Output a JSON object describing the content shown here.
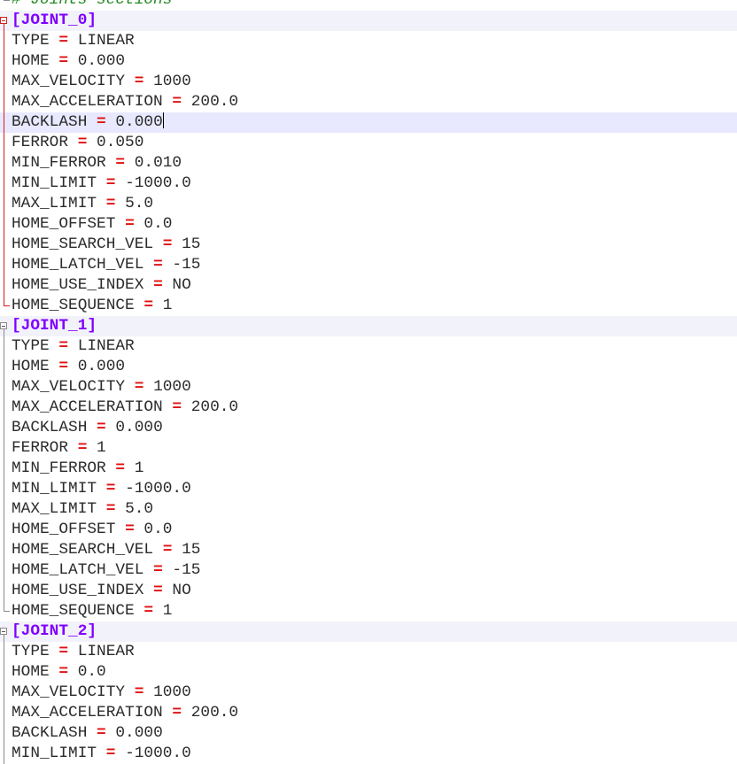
{
  "editor": {
    "comment": "# Joints sections -------------",
    "sections": [
      {
        "header": "[JOINT_0]",
        "entries": [
          {
            "key": "TYPE",
            "value": "LINEAR"
          },
          {
            "key": "HOME",
            "value": "0.000"
          },
          {
            "key": "MAX_VELOCITY",
            "value": "1000"
          },
          {
            "key": "MAX_ACCELERATION",
            "value": "200.0"
          },
          {
            "key": "BACKLASH",
            "value": "0.000"
          },
          {
            "key": "FERROR",
            "value": "0.050"
          },
          {
            "key": "MIN_FERROR",
            "value": "0.010"
          },
          {
            "key": "MIN_LIMIT",
            "value": "-1000.0"
          },
          {
            "key": "MAX_LIMIT",
            "value": "5.0"
          },
          {
            "key": "HOME_OFFSET",
            "value": "0.0"
          },
          {
            "key": "HOME_SEARCH_VEL",
            "value": "15"
          },
          {
            "key": "HOME_LATCH_VEL",
            "value": "-15"
          },
          {
            "key": "HOME_USE_INDEX",
            "value": "NO"
          },
          {
            "key": "HOME_SEQUENCE",
            "value": "1"
          }
        ]
      },
      {
        "header": "[JOINT_1]",
        "entries": [
          {
            "key": "TYPE",
            "value": "LINEAR"
          },
          {
            "key": "HOME",
            "value": "0.000"
          },
          {
            "key": "MAX_VELOCITY",
            "value": "1000"
          },
          {
            "key": "MAX_ACCELERATION",
            "value": "200.0"
          },
          {
            "key": "BACKLASH",
            "value": "0.000"
          },
          {
            "key": "FERROR",
            "value": "1"
          },
          {
            "key": "MIN_FERROR",
            "value": "1"
          },
          {
            "key": "MIN_LIMIT",
            "value": "-1000.0"
          },
          {
            "key": "MAX_LIMIT",
            "value": "5.0"
          },
          {
            "key": "HOME_OFFSET",
            "value": "0.0"
          },
          {
            "key": "HOME_SEARCH_VEL",
            "value": "15"
          },
          {
            "key": "HOME_LATCH_VEL",
            "value": "-15"
          },
          {
            "key": "HOME_USE_INDEX",
            "value": "NO"
          },
          {
            "key": "HOME_SEQUENCE",
            "value": "1"
          }
        ]
      },
      {
        "header": "[JOINT_2]",
        "entries": [
          {
            "key": "TYPE",
            "value": "LINEAR"
          },
          {
            "key": "HOME",
            "value": "0.0"
          },
          {
            "key": "MAX_VELOCITY",
            "value": "1000"
          },
          {
            "key": "MAX_ACCELERATION",
            "value": "200.0"
          },
          {
            "key": "BACKLASH",
            "value": "0.000"
          },
          {
            "key": "MIN_LIMIT",
            "value": "-1000.0"
          }
        ]
      }
    ],
    "operator": "=",
    "active_section_index": 0,
    "caret_line": {
      "section": 0,
      "entry": 4
    }
  },
  "colors": {
    "comment": "#228b22",
    "section_header": "#8000ff",
    "operator": "#e01010",
    "text": "#2b2b2b",
    "current_line": "#e8e8ff",
    "fold_active": "#d22020"
  }
}
